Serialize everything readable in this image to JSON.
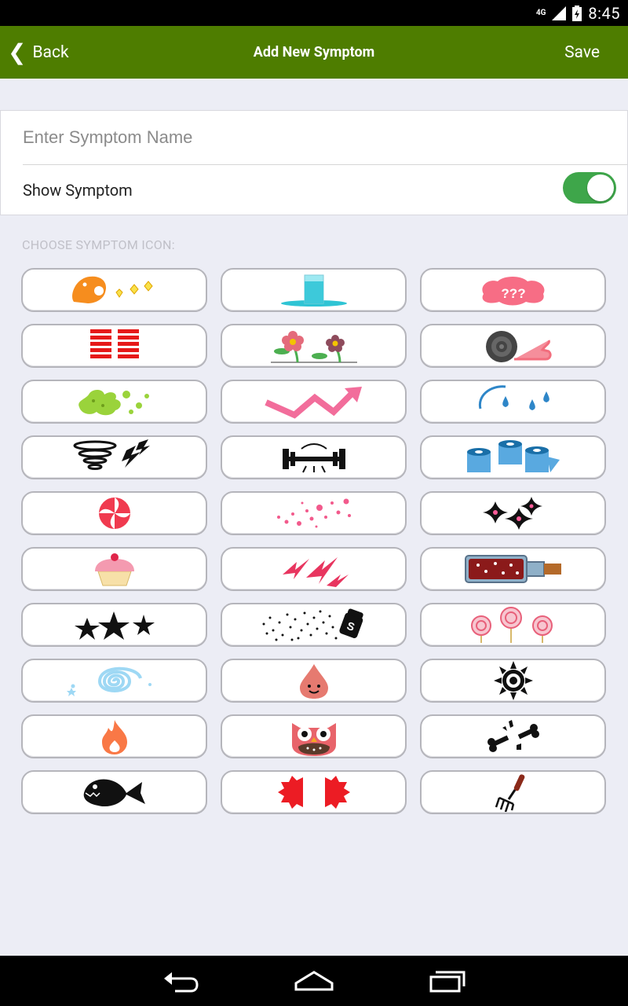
{
  "status_bar": {
    "time": "8:45",
    "network": "4G"
  },
  "app_bar": {
    "back_label": "Back",
    "title": "Add New Symptom",
    "save_label": "Save"
  },
  "form": {
    "name_placeholder": "Enter Symptom Name",
    "name_value": "",
    "show_label": "Show Symptom",
    "show_enabled": true
  },
  "section_label": "CHOOSE SYMPTOM ICON:",
  "icons": [
    "vomit-icon",
    "water-glass-icon",
    "brain-confusion-icon",
    "red-bars-icon",
    "flowers-icon",
    "snail-icon",
    "green-splat-icon",
    "zigzag-arrow-icon",
    "sweat-drops-icon",
    "tornado-lightning-icon",
    "dumbbell-icon",
    "toilet-paper-icon",
    "red-pinwheel-icon",
    "pink-dots-icon",
    "sparkle-hearts-icon",
    "cupcake-icon",
    "pink-lightning-icon",
    "bottle-icon",
    "black-stars-icon",
    "salt-shaker-icon",
    "lollipops-icon",
    "blue-spiral-icon",
    "smiling-drop-icon",
    "black-sun-icon",
    "flame-icon",
    "owl-icon",
    "broken-bone-icon",
    "black-fish-icon",
    "red-split-gear-icon",
    "fork-icon"
  ],
  "colors": {
    "app_bar": "#4e7d00",
    "toggle_on": "#3ea64a",
    "background": "#ecedf5"
  }
}
